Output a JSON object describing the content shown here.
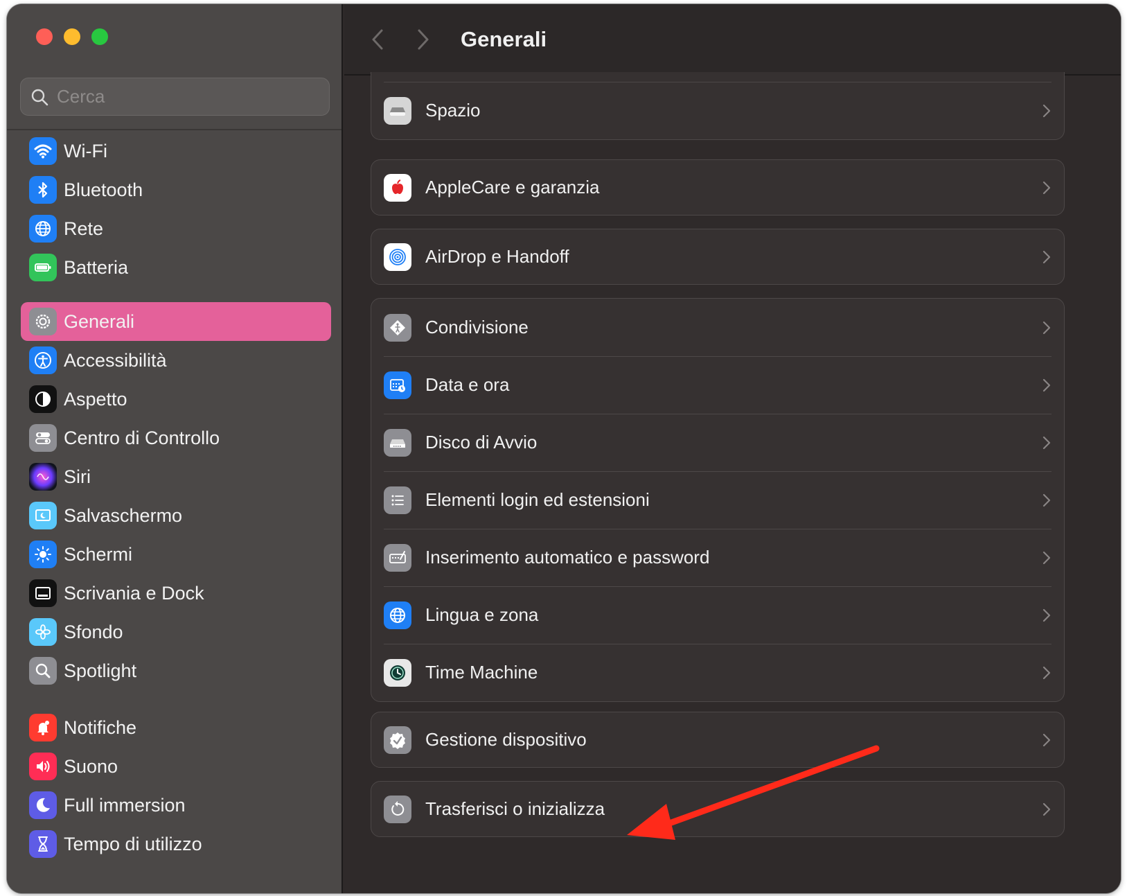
{
  "window": {
    "search_placeholder": "Cerca",
    "title": "Generali"
  },
  "sidebar": {
    "items": [
      {
        "label": "Wi-Fi",
        "icon": "wifi-icon"
      },
      {
        "label": "Bluetooth",
        "icon": "bluetooth-icon"
      },
      {
        "label": "Rete",
        "icon": "globe-icon"
      },
      {
        "label": "Batteria",
        "icon": "battery-icon"
      },
      {
        "label": "Generali",
        "icon": "gear-icon",
        "selected": true
      },
      {
        "label": "Accessibilità",
        "icon": "accessibility-icon"
      },
      {
        "label": "Aspetto",
        "icon": "appearance-icon"
      },
      {
        "label": "Centro di Controllo",
        "icon": "control-center-icon"
      },
      {
        "label": "Siri",
        "icon": "siri-icon"
      },
      {
        "label": "Salvaschermo",
        "icon": "screensaver-icon"
      },
      {
        "label": "Schermi",
        "icon": "brightness-icon"
      },
      {
        "label": "Scrivania e Dock",
        "icon": "dock-icon"
      },
      {
        "label": "Sfondo",
        "icon": "wallpaper-icon"
      },
      {
        "label": "Spotlight",
        "icon": "spotlight-icon"
      },
      {
        "label": "Notifiche",
        "icon": "bell-icon"
      },
      {
        "label": "Suono",
        "icon": "speaker-icon"
      },
      {
        "label": "Full immersion",
        "icon": "moon-icon"
      },
      {
        "label": "Tempo di utilizzo",
        "icon": "hourglass-icon"
      }
    ]
  },
  "main": {
    "rows": [
      {
        "label": "Spazio",
        "icon": "storage-icon"
      },
      {
        "label": "AppleCare e garanzia",
        "icon": "apple-icon"
      },
      {
        "label": "AirDrop e Handoff",
        "icon": "airdrop-icon"
      },
      {
        "label": "Condivisione",
        "icon": "sharing-icon"
      },
      {
        "label": "Data e ora",
        "icon": "calendar-clock-icon"
      },
      {
        "label": "Disco di Avvio",
        "icon": "disk-icon"
      },
      {
        "label": "Elementi login ed estensioni",
        "icon": "list-icon"
      },
      {
        "label": "Inserimento automatico e password",
        "icon": "keyboard-icon"
      },
      {
        "label": "Lingua e zona",
        "icon": "language-globe-icon"
      },
      {
        "label": "Time Machine",
        "icon": "time-machine-icon"
      },
      {
        "label": "Gestione dispositivo",
        "icon": "checkmark-badge-icon"
      },
      {
        "label": "Trasferisci o inizializza",
        "icon": "reset-icon"
      }
    ]
  },
  "colors": {
    "accent_selected": "#e4619a",
    "annotation_arrow": "#ff2a1a"
  }
}
